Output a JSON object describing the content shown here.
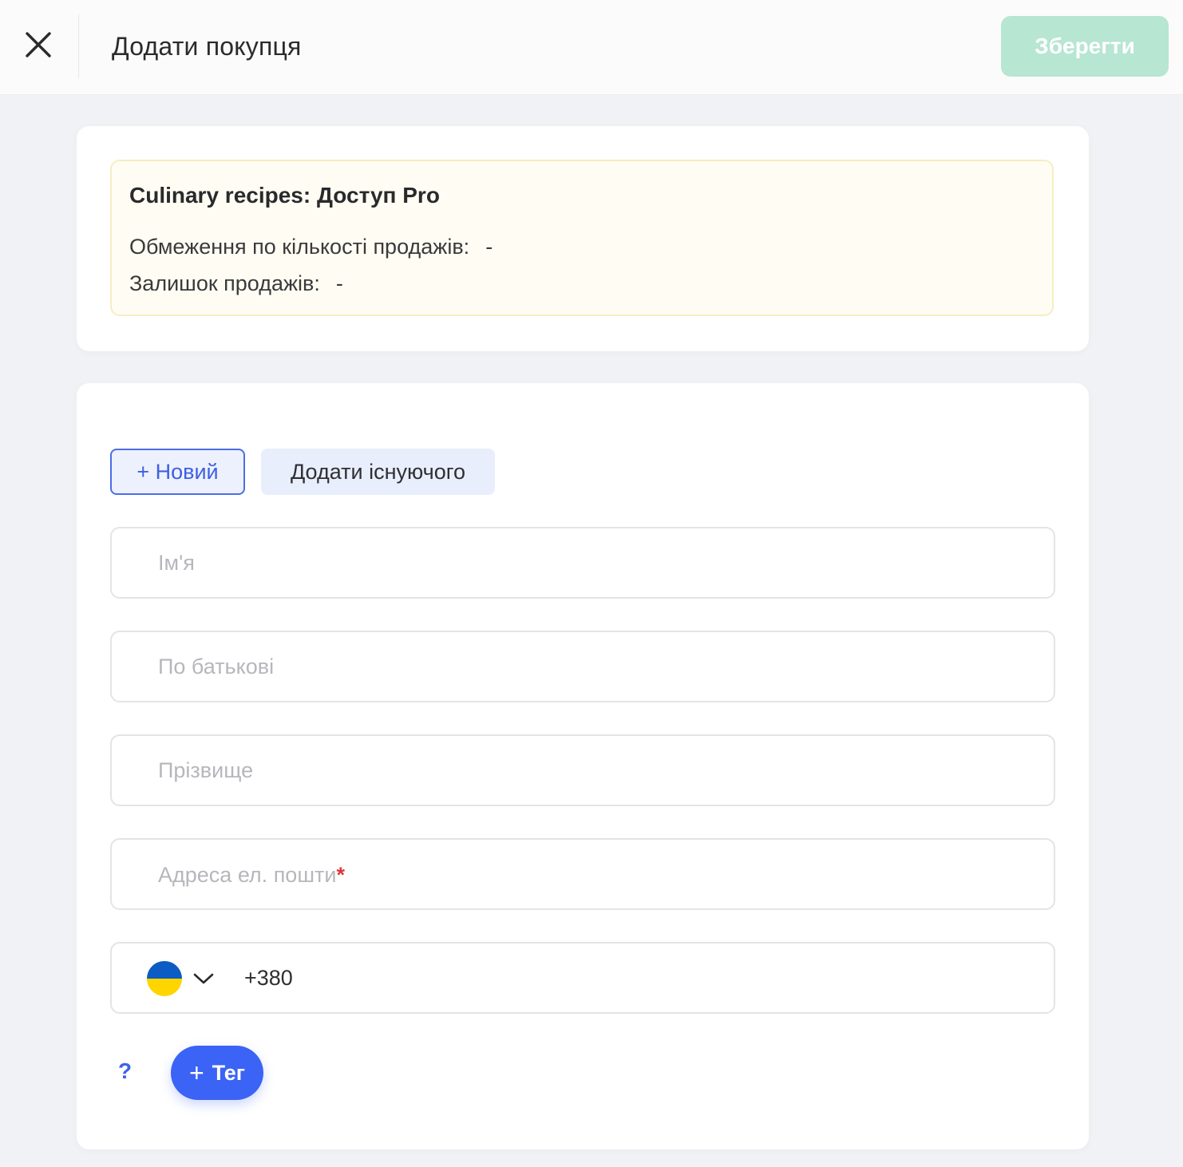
{
  "header": {
    "title": "Додати покупця",
    "save_label": "Зберегти"
  },
  "notice": {
    "title": "Culinary recipes: Доступ Pro",
    "sales_limit_label": "Обмеження по кількості продажів:",
    "sales_limit_value": "-",
    "sales_left_label": "Залишок продажів:",
    "sales_left_value": "-"
  },
  "mode_switch": {
    "new_label": "+ Новий",
    "existing_label": "Додати існуючого"
  },
  "form": {
    "first_name_placeholder": "Ім'я",
    "middle_name_placeholder": "По батькові",
    "last_name_placeholder": "Прізвище",
    "email_placeholder": "Адреса ел. пошти",
    "email_required_mark": "*",
    "phone_country": "ukraine-flag-icon",
    "phone_code": "+380"
  },
  "footer": {
    "help_label": "?",
    "tag_plus": "+",
    "tag_label": "Тег"
  },
  "colors": {
    "accent": "#3b63f5",
    "save_disabled": "#b7e6d2",
    "required": "#e0343c"
  }
}
